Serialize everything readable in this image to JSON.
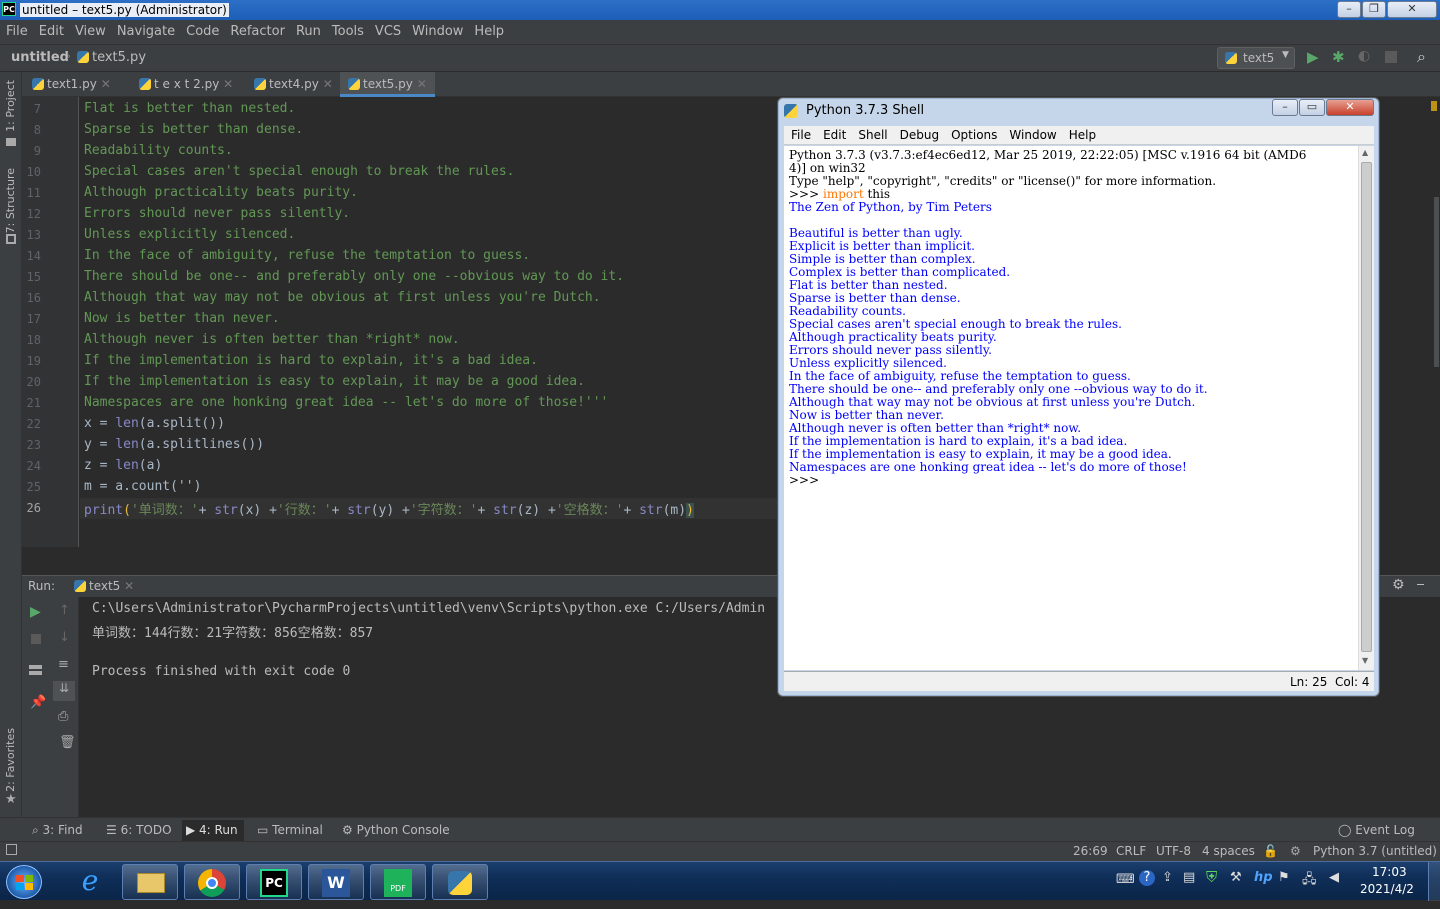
{
  "window": {
    "title": "untitled – text5.py (Administrator)"
  },
  "menu": [
    "File",
    "Edit",
    "View",
    "Navigate",
    "Code",
    "Refactor",
    "Run",
    "Tools",
    "VCS",
    "Window",
    "Help"
  ],
  "breadcrumb": {
    "project": "untitled",
    "file": "text5.py"
  },
  "run_config": {
    "name": "text5"
  },
  "tabs": [
    {
      "label": "text1.py"
    },
    {
      "label": "t e x t 2.py"
    },
    {
      "label": "text4.py"
    },
    {
      "label": "text5.py",
      "active": true
    }
  ],
  "left_panels": {
    "project": "1: Project",
    "structure": "7: Structure",
    "favorites": "2: Favorites"
  },
  "editor": {
    "line_numbers": [
      "7",
      "8",
      "9",
      "10",
      "11",
      "12",
      "13",
      "14",
      "15",
      "16",
      "17",
      "18",
      "19",
      "20",
      "21",
      "22",
      "23",
      "24",
      "25",
      "26"
    ],
    "lines": [
      "Flat is better than nested.",
      "Sparse is better than dense.",
      "Readability counts.",
      "Special cases aren't special enough to break the rules.",
      "Although practicality beats purity.",
      "Errors should never pass silently.",
      "Unless explicitly silenced.",
      "In the face of ambiguity, refuse the temptation to guess.",
      "There should be one-- and preferably only one --obvious way to do it.",
      "Although that way may not be obvious at first unless you're Dutch.",
      "Now is better than never.",
      "Although never is often better than *right* now.",
      "If the implementation is hard to explain, it's a bad idea.",
      "If the implementation is easy to explain, it may be a good idea.",
      "Namespaces are one honking great idea -- let's do more of those!'''"
    ],
    "code": {
      "l22a": "x = ",
      "l22b": "len",
      "l22c": "(a.split())",
      "l23a": "y = ",
      "l23b": "len",
      "l23c": "(a.splitlines())",
      "l24a": "z = ",
      "l24b": "len",
      "l24c": "(a)",
      "l25": "m = a.count('')",
      "l26_print": "print",
      "l26_open": "(",
      "l26_s1": "'单词数：'",
      "l26_p1": "+ ",
      "l26_str1": "str",
      "l26_x": "(x) +",
      "l26_s2": "'行数：'",
      "l26_p2": "+ ",
      "l26_str2": "str",
      "l26_y": "(y) +",
      "l26_s3": "'字符数：'",
      "l26_p3": "+ ",
      "l26_str3": "str",
      "l26_z": "(z) +",
      "l26_s4": "'空格数：'",
      "l26_p4": "+ ",
      "l26_str4": "str",
      "l26_m": "(m)",
      "l26_close": ")"
    }
  },
  "run_panel": {
    "label": "Run:",
    "tab": "text5",
    "output": [
      "C:\\Users\\Administrator\\PycharmProjects\\untitled\\venv\\Scripts\\python.exe C:/Users/Admin",
      "单词数：144行数：21字符数：856空格数：857",
      "",
      "Process finished with exit code 0"
    ]
  },
  "bottom_tabs": [
    {
      "label": "3: Find"
    },
    {
      "label": "6: TODO"
    },
    {
      "label": "4: Run"
    },
    {
      "label": "Terminal"
    },
    {
      "label": "Python Console"
    }
  ],
  "event_log": "Event Log",
  "status": {
    "position": "26:69",
    "line_sep": "CRLF",
    "encoding": "UTF-8",
    "indent": "4 spaces",
    "interpreter": "Python 3.7 (untitled)"
  },
  "idle": {
    "title": "Python 3.7.3 Shell",
    "menu": [
      "File",
      "Edit",
      "Shell",
      "Debug",
      "Options",
      "Window",
      "Help"
    ],
    "header1": "Python 3.7.3 (v3.7.3:ef4ec6ed12, Mar 25 2019, 22:22:05) [MSC v.1916 64 bit (AMD6",
    "header2": "4)] on win32",
    "header3": "Type \"help\", \"copyright\", \"credits\" or \"license()\" for more information.",
    "prompt": ">>> ",
    "import_kw": "import",
    "import_mod": " this",
    "zen": [
      "The Zen of Python, by Tim Peters",
      "",
      "Beautiful is better than ugly.",
      "Explicit is better than implicit.",
      "Simple is better than complex.",
      "Complex is better than complicated.",
      "Flat is better than nested.",
      "Sparse is better than dense.",
      "Readability counts.",
      "Special cases aren't special enough to break the rules.",
      "Although practicality beats purity.",
      "Errors should never pass silently.",
      "Unless explicitly silenced.",
      "In the face of ambiguity, refuse the temptation to guess.",
      "There should be one-- and preferably only one --obvious way to do it.",
      "Although that way may not be obvious at first unless you're Dutch.",
      "Now is better than never.",
      "Although never is often better than *right* now.",
      "If the implementation is hard to explain, it's a bad idea.",
      "If the implementation is easy to explain, it may be a good idea.",
      "Namespaces are one honking great idea -- let's do more of those!"
    ],
    "final_prompt": ">>>",
    "status": {
      "ln": "Ln: 25",
      "col": "Col: 4"
    }
  },
  "taskbar": {
    "time": "17:03",
    "date": "2021/4/2"
  }
}
